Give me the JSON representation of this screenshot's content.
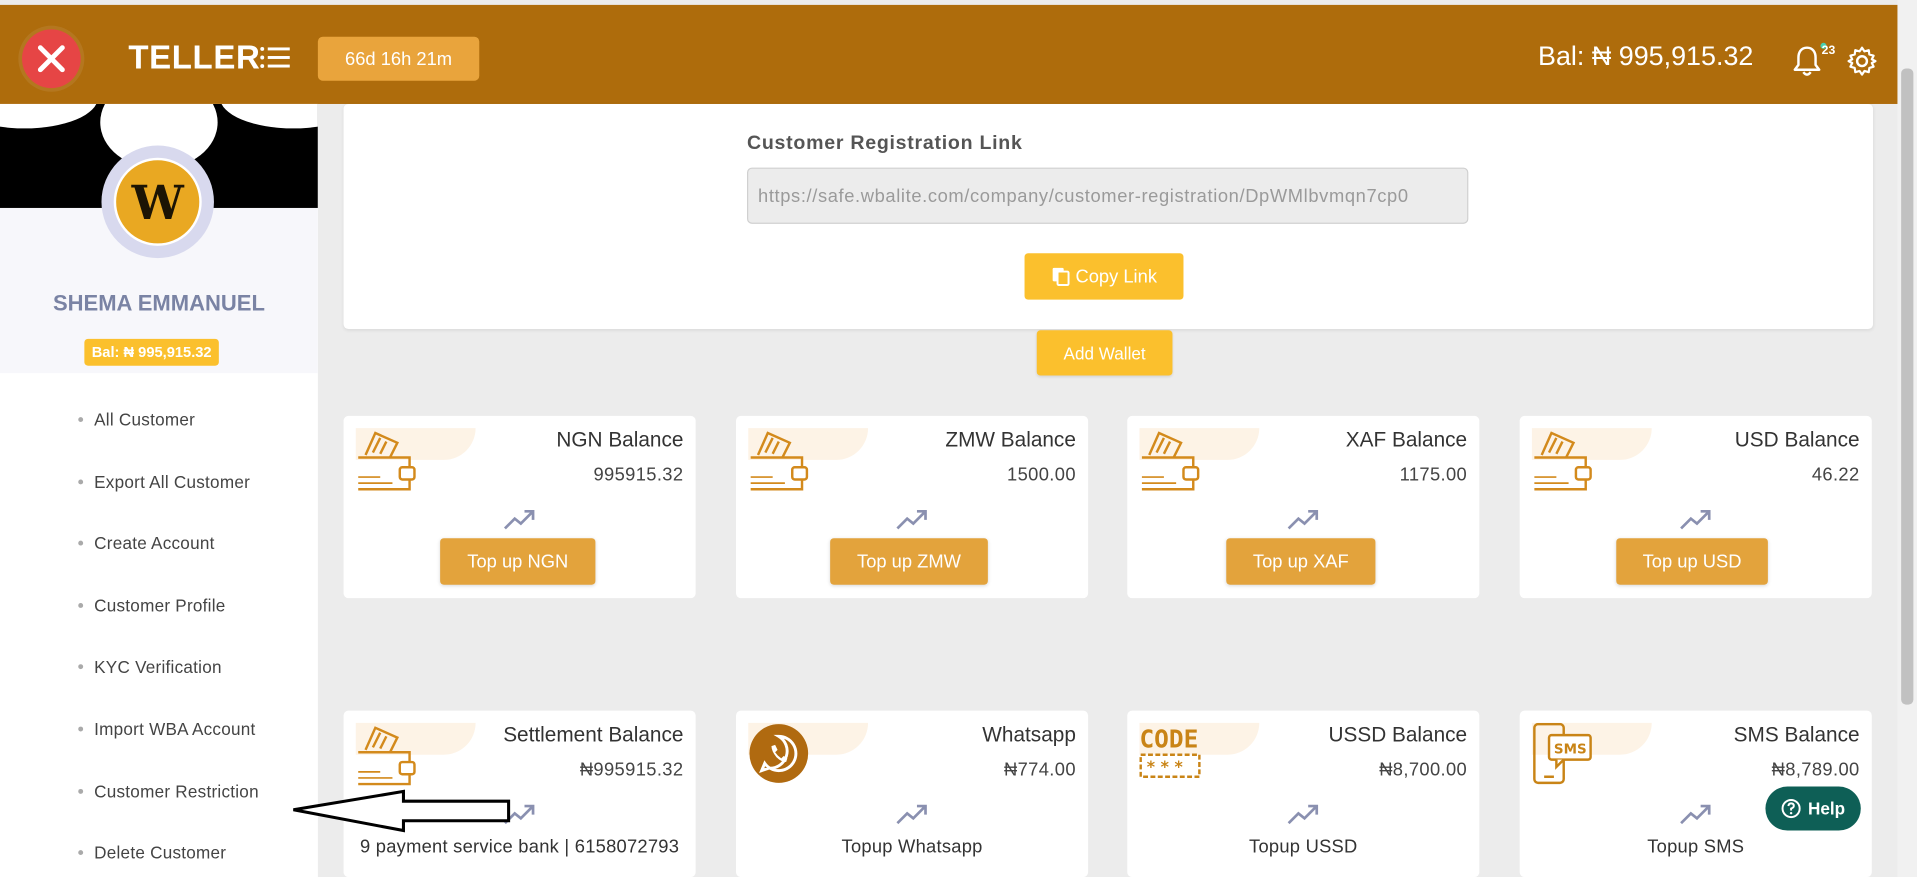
{
  "header": {
    "brand": "TELLER",
    "timer": "66d 16h 21m",
    "balance": "Bal: ₦ 995,915.32",
    "notification_count": "23"
  },
  "profile": {
    "avatar_letter": "W",
    "name": "SHEMA EMMANUEL",
    "balance": "Bal: ₦ 995,915.32"
  },
  "sidebar": {
    "items": [
      {
        "label": "All Customer"
      },
      {
        "label": "Export All Customer"
      },
      {
        "label": "Create Account"
      },
      {
        "label": "Customer Profile"
      },
      {
        "label": "KYC Verification"
      },
      {
        "label": "Import WBA Account"
      },
      {
        "label": "Customer Restriction"
      },
      {
        "label": "Delete Customer"
      }
    ]
  },
  "registration": {
    "label": "Customer Registration Link",
    "link_value": "https://safe.wbalite.com/company/customer-registration/DpWMlbvmqn7cp0",
    "copy_label": "Copy Link"
  },
  "add_wallet_label": "Add Wallet",
  "balances": [
    {
      "title": "NGN Balance",
      "amount": "995915.32",
      "action": "Top up NGN",
      "icon": "wallet-icon"
    },
    {
      "title": "ZMW Balance",
      "amount": "1500.00",
      "action": "Top up ZMW",
      "icon": "wallet-icon"
    },
    {
      "title": "XAF Balance",
      "amount": "1175.00",
      "action": "Top up XAF",
      "icon": "wallet-icon"
    },
    {
      "title": "USD Balance",
      "amount": "46.22",
      "action": "Top up USD",
      "icon": "wallet-icon"
    }
  ],
  "services": [
    {
      "title": "Settlement Balance",
      "amount": "₦995915.32",
      "footer": "9 payment service bank | 6158072793",
      "icon": "wallet-icon"
    },
    {
      "title": "Whatsapp",
      "amount": "₦774.00",
      "footer": "Topup Whatsapp",
      "icon": "whatsapp-icon"
    },
    {
      "title": "USSD Balance",
      "amount": "₦8,700.00",
      "footer": "Topup USSD",
      "icon": "code-icon"
    },
    {
      "title": "SMS Balance",
      "amount": "₦8,789.00",
      "footer": "Topup SMS",
      "icon": "sms-phone-icon"
    }
  ],
  "help_label": "Help",
  "colors": {
    "header": "#ae6c0c",
    "accent": "#fbc02d",
    "topup": "#e3a33c",
    "close": "#e64545",
    "help": "#0e5f56"
  }
}
